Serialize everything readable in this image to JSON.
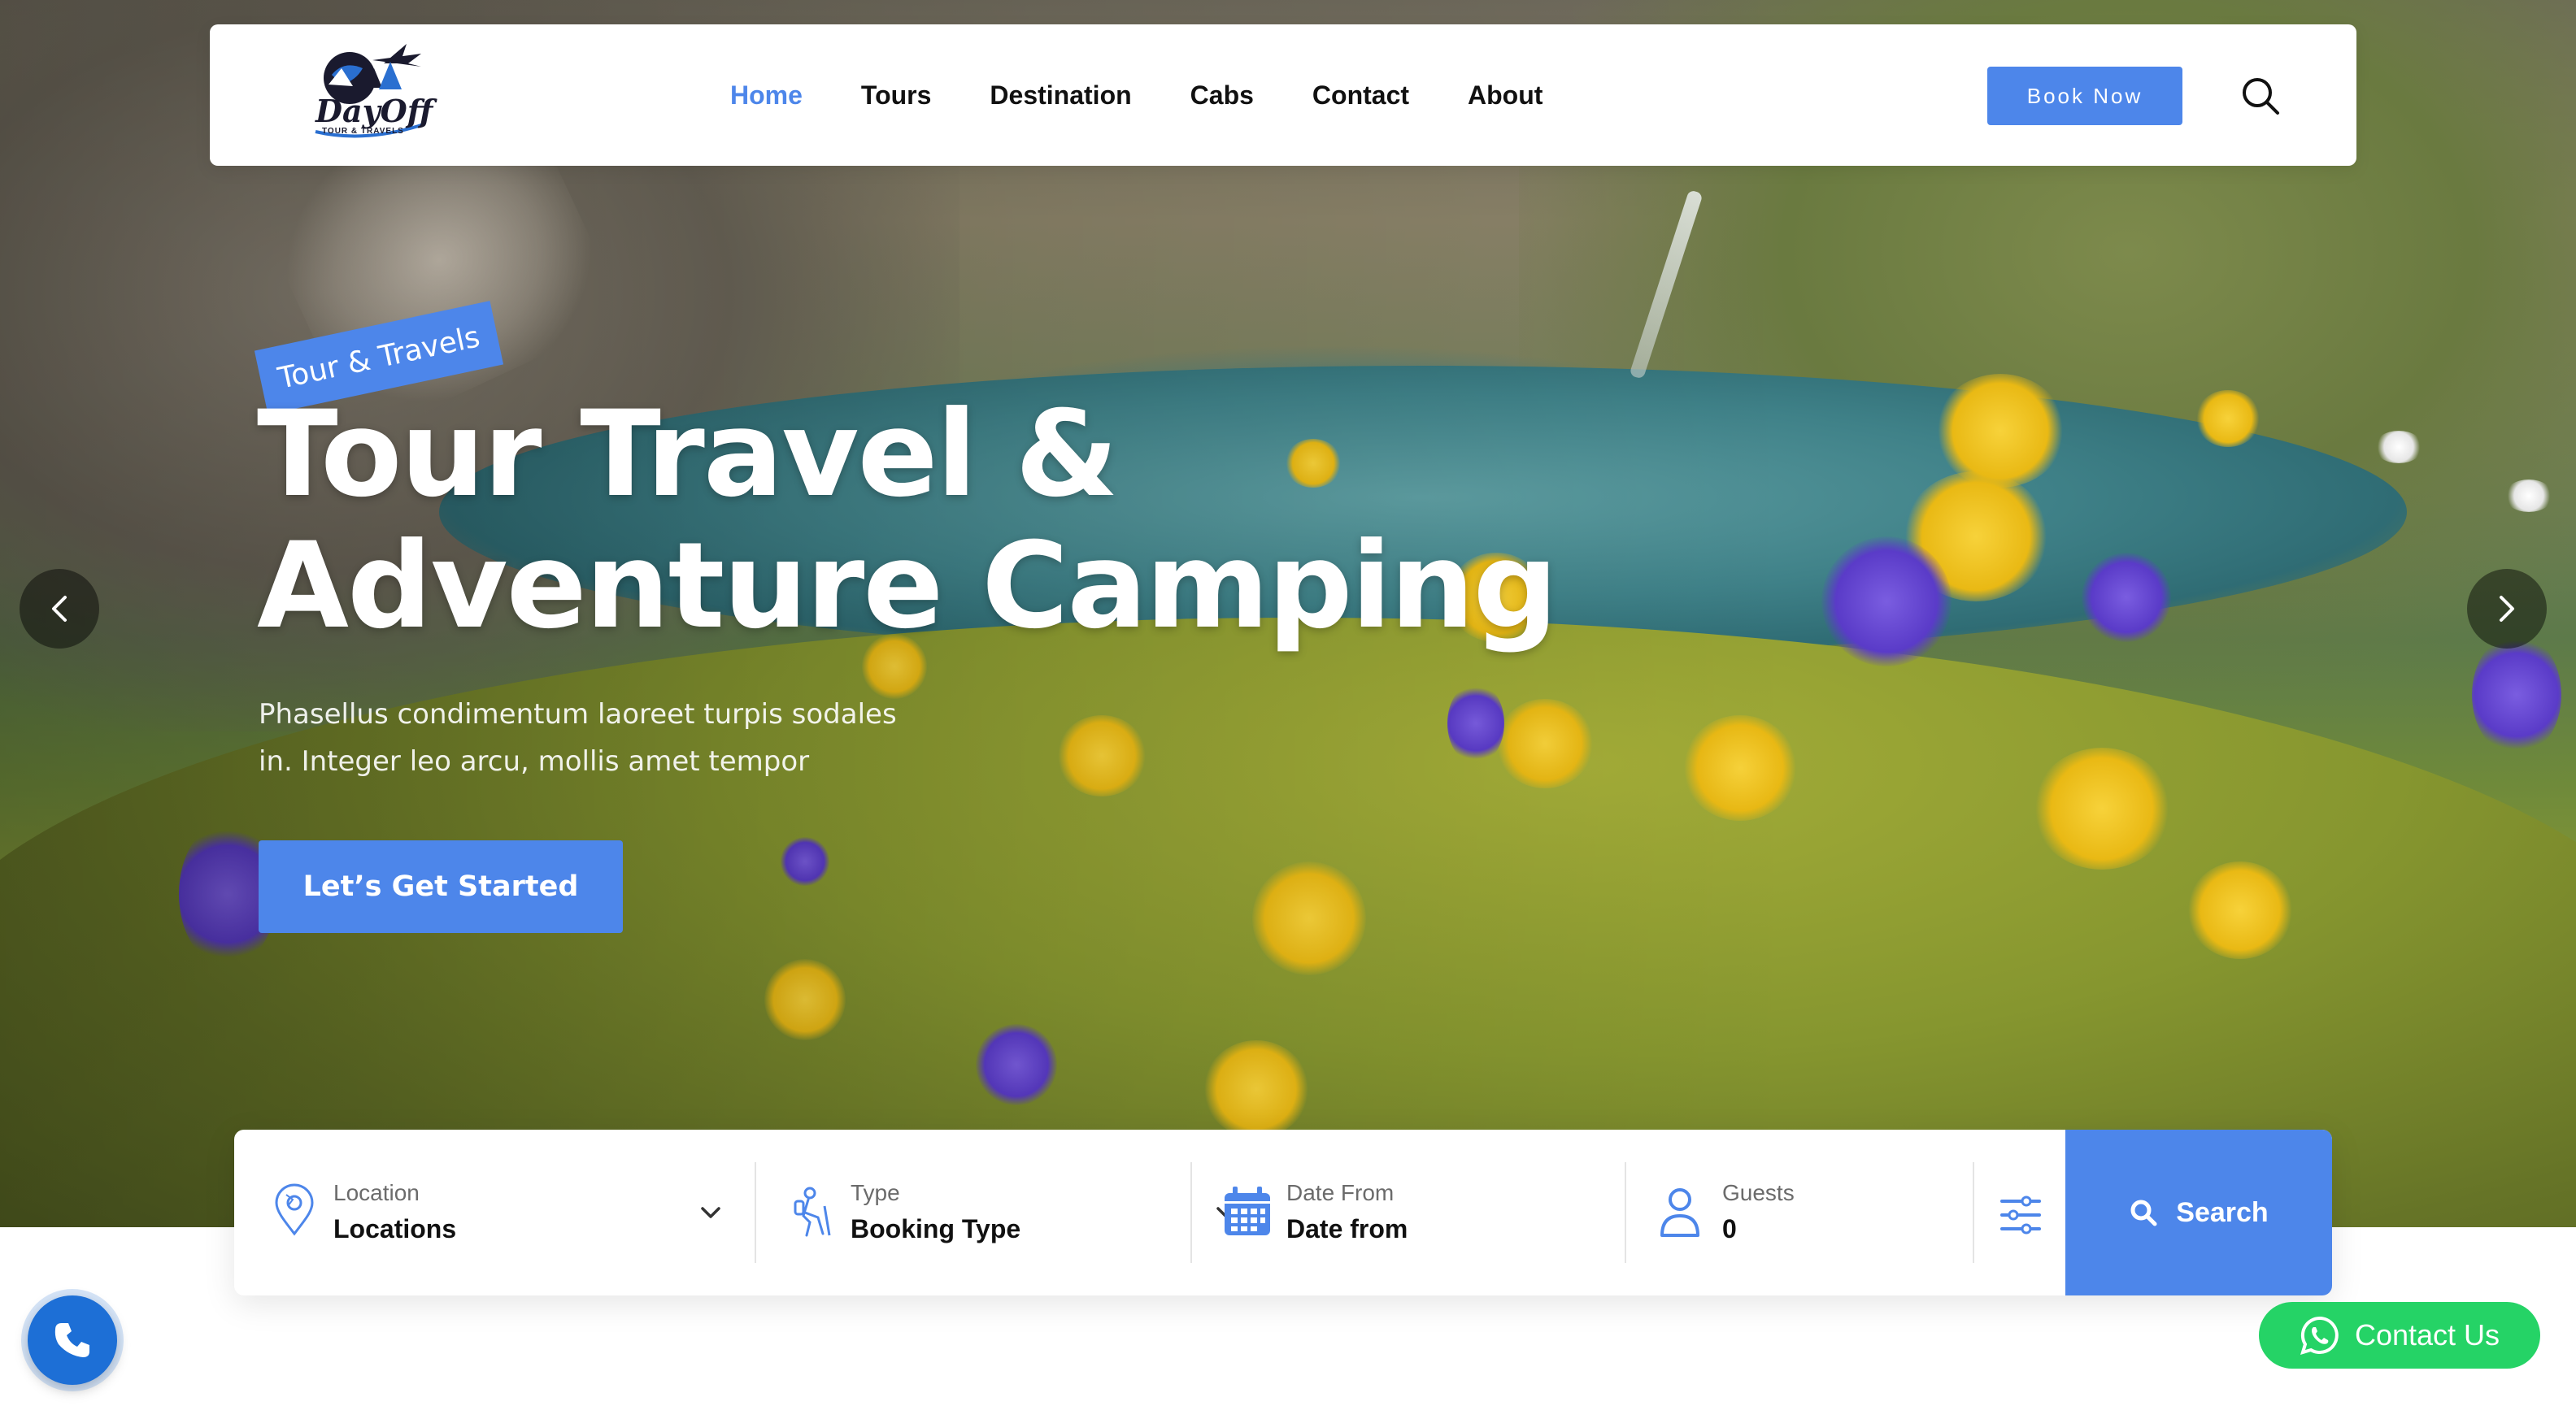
{
  "brand": {
    "logo_name": "DayOff",
    "logo_tagline": "TOUR & TRAVELS"
  },
  "nav": {
    "items": [
      {
        "label": "Home",
        "active": true
      },
      {
        "label": "Tours",
        "active": false
      },
      {
        "label": "Destination",
        "active": false
      },
      {
        "label": "Cabs",
        "active": false
      },
      {
        "label": "Contact",
        "active": false
      },
      {
        "label": "About",
        "active": false
      }
    ],
    "book_label": "Book Now",
    "search_icon": "search-icon"
  },
  "hero": {
    "tag": "Tour & Travels",
    "title_line1": "Tour Travel &",
    "title_line2": "Adventure Camping",
    "subtitle_line1": "Phasellus condimentum laoreet turpis sodales",
    "subtitle_line2": "in. Integer leo arcu, mollis amet tempor",
    "cta_label": "Let’s Get Started",
    "prev_icon": "chevron-left-icon",
    "next_icon": "chevron-right-icon"
  },
  "search": {
    "location": {
      "label": "Location",
      "value": "Locations",
      "icon": "map-pin-icon"
    },
    "type": {
      "label": "Type",
      "value": "Booking Type",
      "icon": "hiker-icon"
    },
    "date": {
      "label": "Date From",
      "value": "Date from",
      "icon": "calendar-icon"
    },
    "guests": {
      "label": "Guests",
      "value": "0",
      "icon": "user-icon"
    },
    "filter_icon": "sliders-icon",
    "submit_label": "Search"
  },
  "widgets": {
    "phone_icon": "phone-icon",
    "contact_label": "Contact Us",
    "contact_icon": "whatsapp-icon"
  },
  "colors": {
    "accent": "#4d86ea",
    "whatsapp": "#25d366",
    "phone": "#1d6fd6"
  }
}
